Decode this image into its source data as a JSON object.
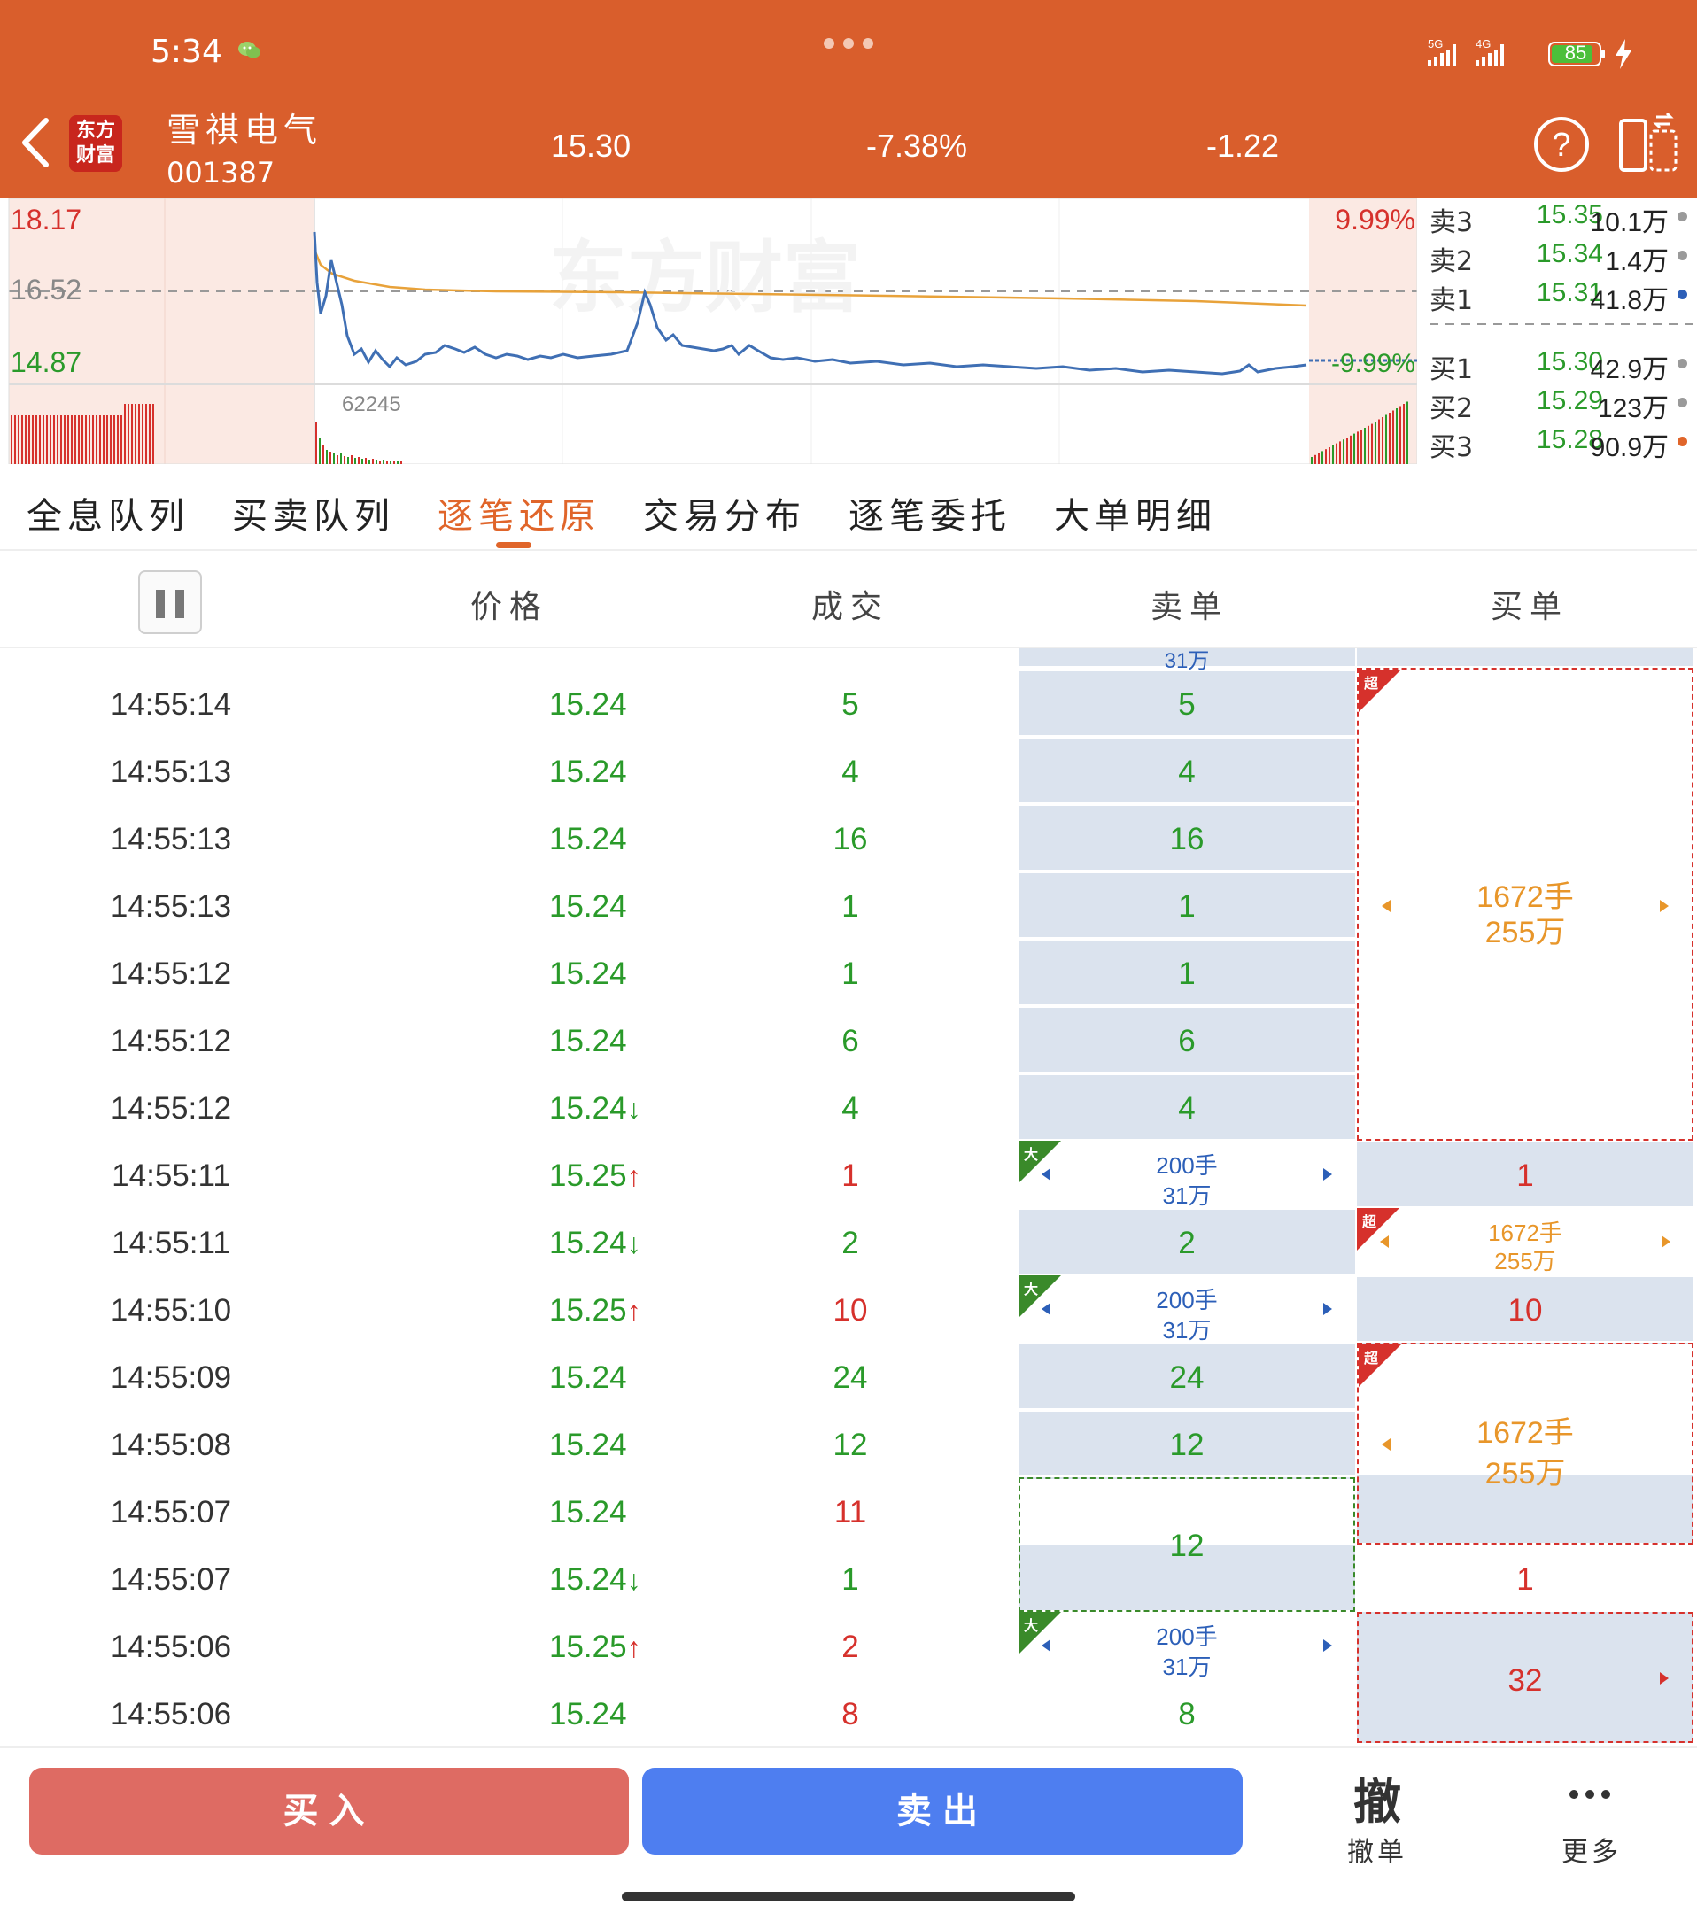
{
  "status_bar": {
    "time": "5:34",
    "battery": "85"
  },
  "header": {
    "logo_line1": "东方",
    "logo_line2": "财富",
    "stock_name": "雪祺电气",
    "stock_code": "001387",
    "price": "15.30",
    "change_pct": "-7.38%",
    "change_amt": "-1.22"
  },
  "chart": {
    "y_high": "18.17",
    "y_mid": "16.52",
    "y_low": "14.87",
    "pct_high": "9.99%",
    "pct_low": "-9.99%",
    "volume_max": "62245",
    "watermark": "东方财富"
  },
  "order_book": {
    "asks": [
      {
        "label": "卖3",
        "price": "15.35",
        "vol": "10.1万",
        "dot_color": "#9a9a9a"
      },
      {
        "label": "卖2",
        "price": "15.34",
        "vol": "1.4万",
        "dot_color": "#9a9a9a"
      },
      {
        "label": "卖1",
        "price": "15.31",
        "vol": "41.8万",
        "dot_color": "#2c5fb8"
      }
    ],
    "bids": [
      {
        "label": "买1",
        "price": "15.30",
        "vol": "42.9万",
        "dot_color": "#9a9a9a"
      },
      {
        "label": "买2",
        "price": "15.29",
        "vol": "123万",
        "dot_color": "#9a9a9a"
      },
      {
        "label": "买3",
        "price": "15.28",
        "vol": "90.9万",
        "dot_color": "#e0652a"
      }
    ]
  },
  "tabs": [
    "全息队列",
    "买卖队列",
    "逐笔还原",
    "交易分布",
    "逐笔委托",
    "大单明细"
  ],
  "columns": {
    "price": "价格",
    "volume": "成交",
    "sell": "卖单",
    "buy": "买单"
  },
  "partial_row": {
    "sell_text": "31万"
  },
  "trades": [
    {
      "time": "14:55:14",
      "price": "15.24",
      "arrow": "",
      "vol": "5",
      "dir": "sell"
    },
    {
      "time": "14:55:13",
      "price": "15.24",
      "arrow": "",
      "vol": "4",
      "dir": "sell"
    },
    {
      "time": "14:55:13",
      "price": "15.24",
      "arrow": "",
      "vol": "16",
      "dir": "sell"
    },
    {
      "time": "14:55:13",
      "price": "15.24",
      "arrow": "",
      "vol": "1",
      "dir": "sell"
    },
    {
      "time": "14:55:12",
      "price": "15.24",
      "arrow": "",
      "vol": "1",
      "dir": "sell"
    },
    {
      "time": "14:55:12",
      "price": "15.24",
      "arrow": "",
      "vol": "6",
      "dir": "sell"
    },
    {
      "time": "14:55:12",
      "price": "15.24",
      "arrow": "↓",
      "vol": "4",
      "dir": "sell"
    },
    {
      "time": "14:55:11",
      "price": "15.25",
      "arrow": "↑",
      "vol": "1",
      "dir": "buy"
    },
    {
      "time": "14:55:11",
      "price": "15.24",
      "arrow": "↓",
      "vol": "2",
      "dir": "sell"
    },
    {
      "time": "14:55:10",
      "price": "15.25",
      "arrow": "↑",
      "vol": "10",
      "dir": "buy"
    },
    {
      "time": "14:55:09",
      "price": "15.24",
      "arrow": "",
      "vol": "24",
      "dir": "sell"
    },
    {
      "time": "14:55:08",
      "price": "15.24",
      "arrow": "",
      "vol": "12",
      "dir": "sell"
    },
    {
      "time": "14:55:07",
      "price": "15.24",
      "arrow": "",
      "vol": "11",
      "dir": "buy"
    },
    {
      "time": "14:55:07",
      "price": "15.24",
      "arrow": "↓",
      "vol": "1",
      "dir": "sell"
    },
    {
      "time": "14:55:06",
      "price": "15.25",
      "arrow": "↑",
      "vol": "2",
      "dir": "buy"
    },
    {
      "time": "14:55:06",
      "price": "15.24",
      "arrow": "",
      "vol": "8",
      "dir": "buy"
    }
  ],
  "sell_cells": [
    "5",
    "4",
    "16",
    "1",
    "1",
    "6",
    "4",
    "",
    "2",
    "",
    "24",
    "12",
    "",
    "",
    "",
    "8"
  ],
  "sell_big_order": {
    "tag": "大",
    "hands": "200手",
    "amount": "31万"
  },
  "sell_merged_12": "12",
  "buy_big_order": {
    "tag": "超",
    "hands": "1672手",
    "amount": "255万"
  },
  "buy_cells": {
    "r7": "1",
    "r9": "10",
    "r13": "1",
    "r14": "32"
  },
  "bottom": {
    "buy": "买入",
    "sell": "卖出",
    "cancel_glyph": "撤",
    "cancel": "撤单",
    "more": "更多"
  }
}
